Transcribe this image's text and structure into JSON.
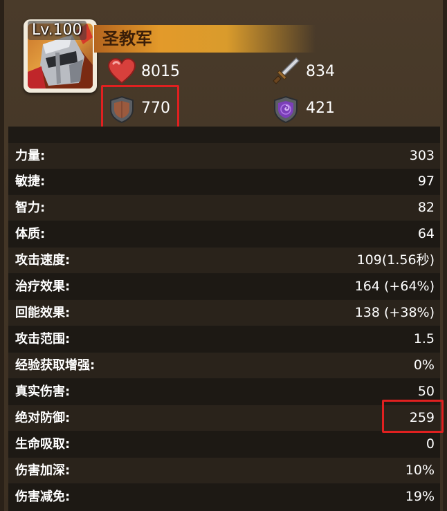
{
  "hero": {
    "level": "Lv.100",
    "name": "圣教军"
  },
  "top_stats": {
    "hp": {
      "icon": "heart-icon",
      "value": "8015"
    },
    "attack": {
      "icon": "sword-icon",
      "value": "834"
    },
    "armor": {
      "icon": "armor-shield-icon",
      "value": "770"
    },
    "magic_resist": {
      "icon": "magic-shield-icon",
      "value": "421"
    }
  },
  "stats": [
    {
      "label": "力量:",
      "value": "303"
    },
    {
      "label": "敏捷:",
      "value": "97"
    },
    {
      "label": "智力:",
      "value": "82"
    },
    {
      "label": "体质:",
      "value": "64"
    },
    {
      "label": "攻击速度:",
      "value": "109(1.56秒)"
    },
    {
      "label": "治疗效果:",
      "value": "164 (+64%)"
    },
    {
      "label": "回能效果:",
      "value": "138 (+38%)"
    },
    {
      "label": "攻击范围:",
      "value": "1.5"
    },
    {
      "label": "经验获取增强:",
      "value": "0%"
    },
    {
      "label": "真实伤害:",
      "value": "50"
    },
    {
      "label": "绝对防御:",
      "value": "259"
    },
    {
      "label": "生命吸取:",
      "value": "0"
    },
    {
      "label": "伤害加深:",
      "value": "10%"
    },
    {
      "label": "伤害减免:",
      "value": "19%"
    }
  ],
  "colors": {
    "highlight": "#e02020",
    "banner": "#e39a2a",
    "row_light": "#2a231b",
    "row_dark": "#1d1914"
  }
}
